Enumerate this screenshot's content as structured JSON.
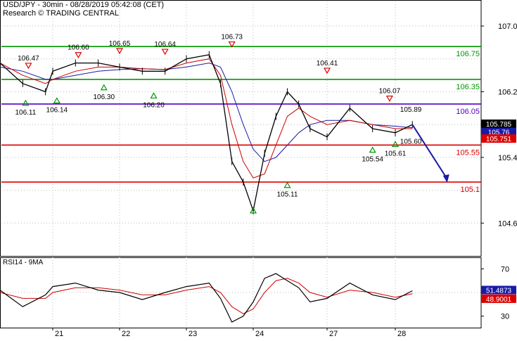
{
  "header": {
    "title": "USD/JPY - 30min - 08/28/2019 05:42:08 (CET)",
    "subtitle": "Research © TRADING CENTRAL"
  },
  "colors": {
    "price": "#000000",
    "ma_red": "#cc0000",
    "ma_blue": "#1a1aa8",
    "resistance": "#009900",
    "support": "#dd0000",
    "pivot": "#5500bb",
    "arrow": "#1a1aa8",
    "grid": "#bbbbbb"
  },
  "chart_data": [
    {
      "type": "line",
      "panel": "price",
      "y_ticks": [
        "107.0",
        "106.2",
        "105.4",
        "104.6"
      ],
      "ylim": [
        104.2,
        107.3
      ],
      "x_ticks": [
        "21",
        "22",
        "23",
        "24",
        "27",
        "28"
      ],
      "x": [
        "20 00:00",
        "20 08:00",
        "20 16:00",
        "21 00:00",
        "21 08:00",
        "21 16:00",
        "22 00:00",
        "22 08:00",
        "22 16:00",
        "23 00:00",
        "23 08:00",
        "23 12:00",
        "23 16:00",
        "23 20:00",
        "24 00:00",
        "24 04:00",
        "24 08:00",
        "24 12:00",
        "24 16:00",
        "24 20:00",
        "27 00:00",
        "27 08:00",
        "27 16:00",
        "28 00:00",
        "28 06:00"
      ],
      "series": [
        {
          "role": "price",
          "values": [
            106.55,
            106.3,
            106.2,
            106.45,
            106.55,
            106.55,
            106.5,
            106.45,
            106.45,
            106.6,
            106.65,
            106.3,
            105.35,
            105.1,
            104.75,
            105.45,
            105.9,
            106.2,
            106.05,
            105.75,
            105.65,
            106.0,
            105.75,
            105.7,
            105.8
          ]
        },
        {
          "role": "ma_red",
          "values": [
            106.55,
            106.4,
            106.3,
            106.35,
            106.45,
            106.5,
            106.5,
            106.48,
            106.47,
            106.55,
            106.6,
            106.4,
            105.8,
            105.35,
            105.15,
            105.2,
            105.55,
            105.9,
            106.0,
            105.9,
            105.8,
            105.85,
            105.8,
            105.75,
            105.75
          ]
        },
        {
          "role": "ma_blue",
          "values": [
            106.5,
            106.45,
            106.35,
            106.35,
            106.4,
            106.45,
            106.47,
            106.48,
            106.47,
            106.5,
            106.55,
            106.5,
            106.2,
            105.8,
            105.5,
            105.35,
            105.4,
            105.55,
            105.7,
            105.8,
            105.85,
            105.85,
            105.8,
            105.78,
            105.76
          ]
        }
      ],
      "levels": [
        {
          "label": "106.75",
          "value": 106.75,
          "kind": "resistance"
        },
        {
          "label": "106.35",
          "value": 106.35,
          "kind": "resistance"
        },
        {
          "label": "106.05",
          "value": 106.05,
          "kind": "pivot"
        },
        {
          "label": "105.55",
          "value": 105.55,
          "kind": "support"
        },
        {
          "label": "105.1",
          "value": 105.1,
          "kind": "support"
        }
      ],
      "last_values": [
        {
          "label": "105.785",
          "value": 105.81,
          "bg": "#000000"
        },
        {
          "label": "105.76",
          "value": 105.71,
          "bg": "#1a1aa8"
        },
        {
          "label": "105.751",
          "value": 105.63,
          "bg": "#dd0000"
        }
      ],
      "markers": [
        {
          "x": "20 10:00",
          "value": 106.47,
          "label": "106.47",
          "kind": "high"
        },
        {
          "x": "20 09:00",
          "value": 106.11,
          "label": "106.11",
          "kind": "low"
        },
        {
          "x": "20 20:00",
          "value": 106.14,
          "label": "106.14",
          "kind": "low"
        },
        {
          "x": "21 09:00",
          "value": 106.6,
          "label": "106.60",
          "kind": "high"
        },
        {
          "x": "21 18:00",
          "value": 106.3,
          "label": "106.30",
          "kind": "low"
        },
        {
          "x": "22 00:00",
          "value": 106.65,
          "label": "106.65",
          "kind": "high"
        },
        {
          "x": "22 12:00",
          "value": 106.2,
          "label": "106.20",
          "kind": "low"
        },
        {
          "x": "22 16:00",
          "value": 106.64,
          "label": "106.64",
          "kind": "high"
        },
        {
          "x": "23 16:00",
          "value": 106.73,
          "label": "106.73",
          "kind": "high"
        },
        {
          "x": "24 00:00",
          "value": 104.8,
          "label": "",
          "kind": "low"
        },
        {
          "x": "24 12:00",
          "value": 105.11,
          "label": "105.11",
          "kind": "low"
        },
        {
          "x": "27 00:00",
          "value": 106.41,
          "label": "106.41",
          "kind": "high"
        },
        {
          "x": "27 16:00",
          "value": 105.54,
          "label": "105.54",
          "kind": "low"
        },
        {
          "x": "27 22:00",
          "value": 106.07,
          "label": "106.07",
          "kind": "high"
        },
        {
          "x": "28 00:00",
          "value": 105.61,
          "label": "105.61",
          "kind": "low"
        }
      ],
      "annotations": [
        {
          "x": "28 02:00",
          "value": 105.99,
          "label": "105.89"
        },
        {
          "x": "28 02:00",
          "value": 105.6,
          "label": "105.60"
        }
      ],
      "projection": {
        "from_x": "28 06:00",
        "from_value": 105.8,
        "to_x": "28 18:00",
        "to_value": 105.1
      }
    },
    {
      "type": "line",
      "panel": "rsi",
      "title": "RSI14 - 9MA",
      "y_ticks": [
        "70",
        "30"
      ],
      "ylim": [
        25,
        75
      ],
      "series": [
        {
          "role": "rsi",
          "values": [
            52,
            38,
            48,
            55,
            58,
            52,
            50,
            44,
            50,
            55,
            58,
            45,
            25,
            30,
            42,
            62,
            66,
            60,
            54,
            42,
            45,
            58,
            48,
            44,
            51.4873
          ]
        },
        {
          "role": "ma",
          "values": [
            50,
            45,
            45,
            50,
            54,
            54,
            52,
            48,
            48,
            52,
            55,
            50,
            38,
            32,
            36,
            50,
            60,
            62,
            58,
            50,
            46,
            52,
            50,
            46,
            48.9001
          ]
        }
      ],
      "last_values": [
        {
          "label": "51.4873",
          "bg": "#1a1aa8"
        },
        {
          "label": "48.9001",
          "bg": "#dd0000"
        }
      ]
    }
  ]
}
